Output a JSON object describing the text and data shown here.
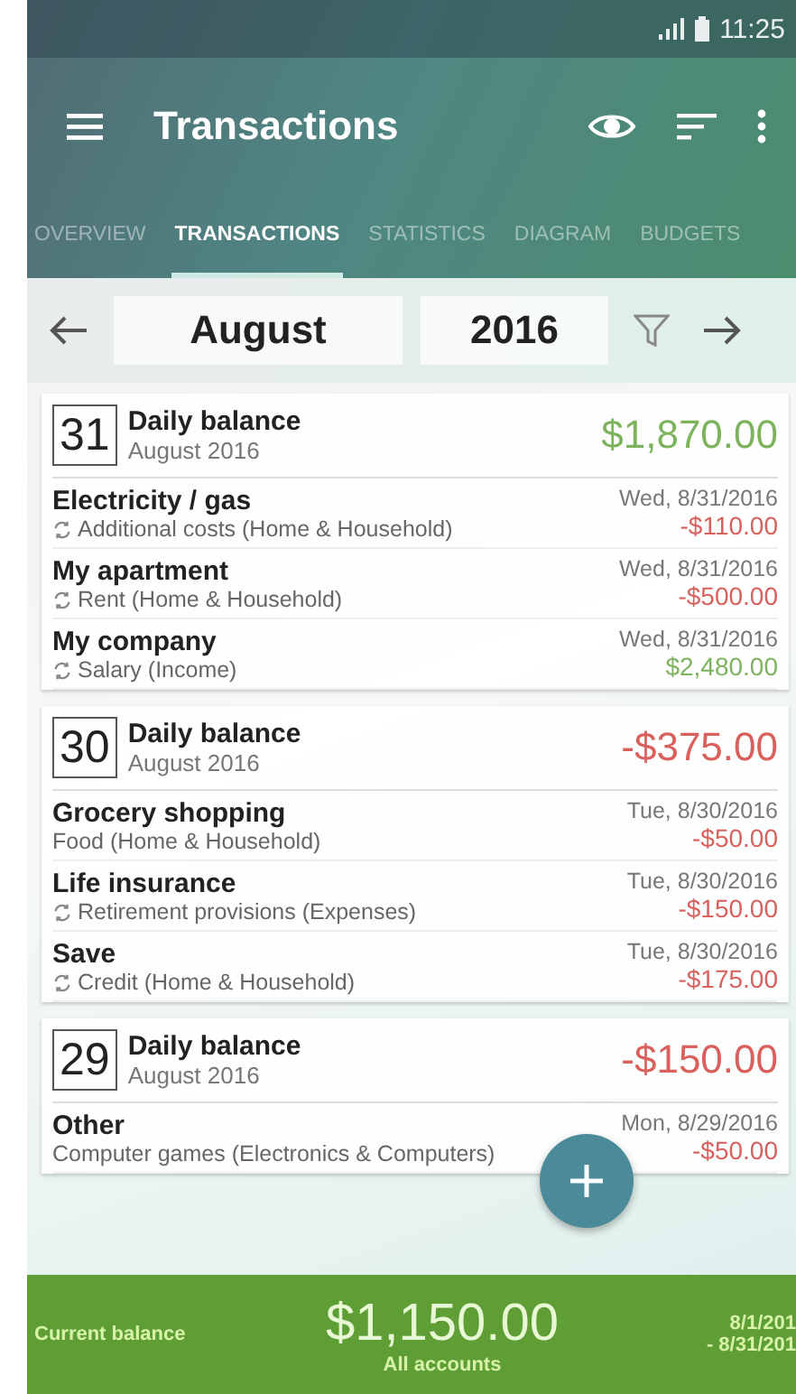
{
  "status_bar": {
    "time": "11:25"
  },
  "toolbar": {
    "title": "Transactions"
  },
  "tabs": [
    {
      "label": "OVERVIEW",
      "selected": false
    },
    {
      "label": "TRANSACTIONS",
      "selected": true
    },
    {
      "label": "STATISTICS",
      "selected": false
    },
    {
      "label": "DIAGRAM",
      "selected": false
    },
    {
      "label": "BUDGETS",
      "selected": false
    }
  ],
  "period": {
    "month": "August",
    "year": "2016"
  },
  "days": [
    {
      "day": "31",
      "title": "Daily balance",
      "subtitle": "August 2016",
      "balance": "$1,870.00",
      "kind": "income",
      "transactions": [
        {
          "name": "Electricity / gas",
          "category": "Additional costs (Home & Household)",
          "recurring": true,
          "date": "Wed, 8/31/2016",
          "amount": "-$110.00",
          "kind": "expense"
        },
        {
          "name": "My apartment",
          "category": "Rent (Home & Household)",
          "recurring": true,
          "date": "Wed, 8/31/2016",
          "amount": "-$500.00",
          "kind": "expense"
        },
        {
          "name": "My company",
          "category": "Salary (Income)",
          "recurring": true,
          "date": "Wed, 8/31/2016",
          "amount": "$2,480.00",
          "kind": "income"
        }
      ]
    },
    {
      "day": "30",
      "title": "Daily balance",
      "subtitle": "August 2016",
      "balance": "-$375.00",
      "kind": "expense",
      "transactions": [
        {
          "name": "Grocery shopping",
          "category": "Food (Home & Household)",
          "recurring": false,
          "date": "Tue, 8/30/2016",
          "amount": "-$50.00",
          "kind": "expense"
        },
        {
          "name": "Life insurance",
          "category": "Retirement provisions (Expenses)",
          "recurring": true,
          "date": "Tue, 8/30/2016",
          "amount": "-$150.00",
          "kind": "expense"
        },
        {
          "name": "Save",
          "category": "Credit (Home & Household)",
          "recurring": true,
          "date": "Tue, 8/30/2016",
          "amount": "-$175.00",
          "kind": "expense"
        }
      ]
    },
    {
      "day": "29",
      "title": "Daily balance",
      "subtitle": "August 2016",
      "balance": "-$150.00",
      "kind": "expense",
      "transactions": [
        {
          "name": "Other",
          "category": "Computer games (Electronics & Computers)",
          "recurring": false,
          "date": "Mon, 8/29/2016",
          "amount": "-$50.00",
          "kind": "expense"
        }
      ]
    }
  ],
  "footer": {
    "label": "Current balance",
    "amount": "$1,150.00",
    "account": "All accounts",
    "range_start": "8/1/201",
    "range_end": "- 8/31/201"
  }
}
